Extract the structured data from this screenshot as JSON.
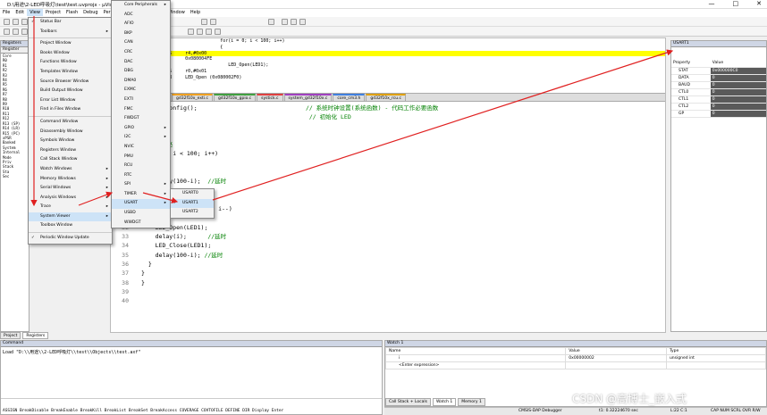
{
  "title": "D:\\用途\\2-LED呼吸灯\\test\\test.uvprojx - µVision",
  "menubar": [
    "File",
    "Edit",
    "View",
    "Project",
    "Flash",
    "Debug",
    "Peripherals",
    "Tools",
    "SVCS",
    "Window",
    "Help"
  ],
  "registers_panel": {
    "title": "Registers",
    "header": "Register",
    "rows": [
      "Core",
      "R0",
      "R1",
      "R2",
      "R3",
      "R4",
      "R5",
      "R6",
      "R7",
      "R8",
      "R9",
      "R10",
      "R11",
      "R12",
      "R13 (SP)",
      "R14 (LR)",
      "R15 (PC)",
      "xPSR",
      "Banked",
      "System",
      "Internal",
      "Mode",
      "Priv",
      "Stack",
      "Sta",
      "Sec"
    ]
  },
  "disasm": [
    {
      "text": "                        for(i = 0; i < 100; i++)",
      "hl": false
    },
    {
      "text": "                        {",
      "hl": false
    },
    {
      "text": "  MOVS     r4,#0x00",
      "hl": true
    },
    {
      "text": "  B        0x080004FE",
      "hl": false
    },
    {
      "text": "                           LED_Open(LED1);",
      "hl": false
    },
    {
      "text": "  MOVS     r0,#0x01",
      "hl": false
    },
    {
      "text": "  BL.W     LED_Open (0x080002F0)",
      "hl": false
    }
  ],
  "tabs": [
    "gd32f10x_exti.c",
    "gd32f10x_gpio.c",
    "systick.c",
    "system_gd32f10x.c",
    "core_cm3.h",
    "gd32f10x_rcu.c"
  ],
  "code": [
    {
      "n": "",
      "t": "    sk_config();",
      "c": "                               // 系统时钟设置(系统函数) - 代码工作必要函数"
    },
    {
      "n": "",
      "t": "    t();",
      "c": "                                        // 初始化 LED"
    },
    {
      "n": "",
      "t": "",
      "c": ""
    },
    {
      "n": "",
      "t": "    1)",
      "c": ""
    },
    {
      "n": "",
      "t": "",
      "c": "    渐变亮"
    },
    {
      "n": "",
      "t": "    = 0; i < 100; i++)",
      "c": ""
    },
    {
      "n": "",
      "t": "",
      "c": ""
    },
    {
      "n": "",
      "t": "",
      "c": ""
    },
    {
      "n": "",
      "t": "    delay(100-i);",
      "c": "  //延时"
    },
    {
      "n": "",
      "t": "  }",
      "c": ""
    },
    {
      "n": "",
      "t": "  ",
      "c": "// 逐渐变暗"
    },
    {
      "n": "",
      "t": "  for(i = 100; i > 0; i--)",
      "c": ""
    },
    {
      "n": "31",
      "t": "  {",
      "c": ""
    },
    {
      "n": "32",
      "t": "    LED_Open(LED1);",
      "c": ""
    },
    {
      "n": "33",
      "t": "    delay(i);",
      "c": "      //延时"
    },
    {
      "n": "34",
      "t": "    LED_Close(LED1);",
      "c": ""
    },
    {
      "n": "35",
      "t": "    delay(100-i);",
      "c": " //延时"
    },
    {
      "n": "36",
      "t": "  }",
      "c": ""
    },
    {
      "n": "37",
      "t": "}",
      "c": ""
    },
    {
      "n": "38",
      "t": "}",
      "c": ""
    },
    {
      "n": "39",
      "t": "",
      "c": ""
    },
    {
      "n": "40",
      "t": "",
      "c": ""
    }
  ],
  "usart_panel": {
    "title": "USART1",
    "col_property": "Property",
    "col_value": "Value",
    "rows": [
      {
        "p": "STAT",
        "v": "0x000000C0"
      },
      {
        "p": "DATA",
        "v": "0"
      },
      {
        "p": "BAUD",
        "v": "0"
      },
      {
        "p": "CTL0",
        "v": "0"
      },
      {
        "p": "CTL1",
        "v": "0"
      },
      {
        "p": "CTL2",
        "v": "0"
      },
      {
        "p": "GP",
        "v": "0"
      }
    ]
  },
  "command_panel": {
    "title": "Command",
    "line": "Load \"D:\\\\用途\\\\2-LED呼吸灯\\\\test\\\\Objects\\\\test.axf\"",
    "commands": "ASSIGN BreakDisable BreakEnable BreakKill BreakList BreakSet BreakAccess COVERAGE COVTOFILE DEFINE DIR Display Enter"
  },
  "bottom_tabs": [
    "Project",
    "Registers"
  ],
  "watch_panel": {
    "title": "Watch 1",
    "cols": [
      "Name",
      "Value",
      "Type"
    ],
    "rows": [
      {
        "name": "i",
        "value": "0x00000002",
        "type": "unsigned int"
      },
      {
        "name": "<Enter expression>",
        "value": "",
        "type": ""
      }
    ],
    "tabs": [
      "Call Stack + Locals",
      "Watch 1",
      "Memory 1"
    ]
  },
  "status": {
    "debugger": "CMSIS-DAP Debugger",
    "time": "t1: 0.32224670 sec",
    "pos": "L:22 C:1",
    "flags": "CAP NUM SCRL OVR R/W"
  },
  "view_menu": [
    {
      "label": "Status Bar",
      "check": true
    },
    {
      "label": "Toolbars",
      "arrow": true
    },
    {
      "sep": true
    },
    {
      "label": "Project Window"
    },
    {
      "label": "Books Window"
    },
    {
      "label": "Functions Window"
    },
    {
      "label": "Templates Window"
    },
    {
      "label": "Source Browser Window"
    },
    {
      "label": "Build Output Window"
    },
    {
      "label": "Error List Window"
    },
    {
      "label": "Find in Files Window"
    },
    {
      "sep": true
    },
    {
      "label": "Command Window"
    },
    {
      "label": "Disassembly Window"
    },
    {
      "label": "Symbols Window"
    },
    {
      "label": "Registers Window"
    },
    {
      "label": "Call Stack Window"
    },
    {
      "label": "Watch Windows",
      "arrow": true
    },
    {
      "label": "Memory Windows",
      "arrow": true
    },
    {
      "label": "Serial Windows",
      "arrow": true
    },
    {
      "label": "Analysis Windows",
      "arrow": true
    },
    {
      "label": "Trace",
      "arrow": true
    },
    {
      "label": "System Viewer",
      "arrow": true,
      "sel": true
    },
    {
      "label": "Toolbox Window"
    },
    {
      "sep": true
    },
    {
      "label": "Periodic Window Update",
      "check": true
    }
  ],
  "sv_menu": [
    "Core Peripherals",
    "ADC",
    "AFIO",
    "BKP",
    "CAN",
    "CRC",
    "DAC",
    "DBG",
    "DMA0",
    "EXMC",
    "EXTI",
    "FMC",
    "FWDGT",
    "GPIO",
    "I2C",
    "NVIC",
    "PMU",
    "RCU",
    "RTC",
    "SPI",
    "TIMER",
    "USART",
    "USBD",
    "WWDGT"
  ],
  "usart_menu": [
    {
      "label": "USART0"
    },
    {
      "label": "USART1",
      "check": true,
      "sel": true
    },
    {
      "label": "USART2"
    }
  ],
  "watermark": "CSDN @高博士_嵌入式",
  "colors": {
    "arrow": "#e02020",
    "highlight": "#ffff00",
    "selection": "#cde3f7"
  }
}
